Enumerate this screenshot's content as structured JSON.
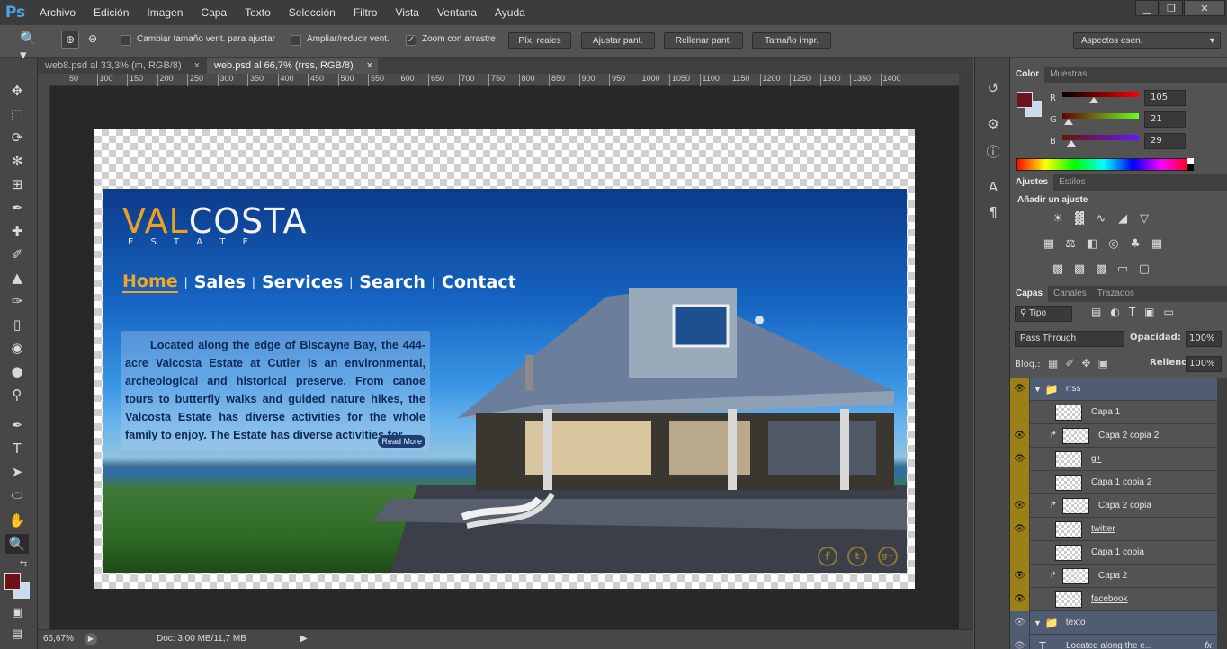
{
  "app": {
    "logo": "Ps"
  },
  "menu": [
    "Archivo",
    "Edición",
    "Imagen",
    "Capa",
    "Texto",
    "Selección",
    "Filtro",
    "Vista",
    "Ventana",
    "Ayuda"
  ],
  "window_controls": {
    "minimize": "▁",
    "restore": "❐",
    "close": "✕"
  },
  "options": {
    "resize_window_label": "Cambiar tamaño vent. para ajustar",
    "resize_window_checked": false,
    "zoom_all_label": "Ampliar/reducir vent.",
    "zoom_all_checked": false,
    "scrubby_zoom_label": "Zoom con arrastre",
    "scrubby_zoom_checked": true,
    "actual_pixels": "Píx. reales",
    "fit_screen": "Ajustar pant.",
    "fill_screen": "Rellenar pant.",
    "print_size": "Tamaño impr.",
    "workspace": "Aspectos esen."
  },
  "tabs": [
    {
      "label": "web8.psd al 33,3% (m, RGB/8)",
      "active": false
    },
    {
      "label": "web.psd al 66,7% (rrss, RGB/8)",
      "active": true
    }
  ],
  "ruler_ticks": [
    "50",
    "100",
    "150",
    "200",
    "250",
    "300",
    "350",
    "400",
    "450",
    "500",
    "550",
    "600",
    "650",
    "700",
    "750",
    "800",
    "850",
    "900",
    "950",
    "1000",
    "1050",
    "1100",
    "1150",
    "1200",
    "1250",
    "1300",
    "1350",
    "1400"
  ],
  "website": {
    "logo_val": "VAL",
    "logo_costa": "COSTA",
    "logo_estate": "E S T A T E",
    "nav": [
      "Home",
      "Sales",
      "Services",
      "Search",
      "Contact"
    ],
    "intro": "Located along the edge of Biscayne Bay, the 444-acre Valcosta Estate at Cutler is an environmental, archeological and historical preserve. From canoe tours to butterfly walks and guided nature hikes, the Valcosta Estate has diverse activities for the whole family to enjoy. The Estate has diverse activities for...",
    "read_more": "Read More",
    "social": [
      "f",
      "t",
      "g+"
    ]
  },
  "status": {
    "zoom": "66,67%",
    "doc": "Doc: 3,00 MB/11,7 MB"
  },
  "color_panel": {
    "tabs": [
      "Color",
      "Muestras"
    ],
    "r_label": "R",
    "r_value": "105",
    "g_label": "G",
    "g_value": "21",
    "b_label": "B",
    "b_value": "29",
    "foreground": "#69151d",
    "background": "#c8dcf0"
  },
  "adjust_panel": {
    "tabs": [
      "Ajustes",
      "Estilos"
    ],
    "title": "Añadir un ajuste"
  },
  "layers_panel": {
    "tabs": [
      "Capas",
      "Canales",
      "Trazados"
    ],
    "filter": "Tipo",
    "blend_mode": "Pass Through",
    "opacity_label": "Opacidad:",
    "opacity": "100%",
    "lock_label": "Bloq.:",
    "fill_label": "Relleno:",
    "fill": "100%",
    "layers": [
      {
        "name": "rrss",
        "type": "group",
        "visible": true
      },
      {
        "name": "Capa 1",
        "type": "layer",
        "visible": false,
        "clip": false
      },
      {
        "name": "Capa 2 copia 2",
        "type": "layer",
        "visible": true,
        "clip": true
      },
      {
        "name": "g+",
        "type": "layer",
        "visible": true,
        "clip": false,
        "underline": true
      },
      {
        "name": "Capa 1 copia 2",
        "type": "layer",
        "visible": false,
        "clip": false
      },
      {
        "name": "Capa 2 copia",
        "type": "layer",
        "visible": true,
        "clip": true
      },
      {
        "name": "twitter",
        "type": "layer",
        "visible": true,
        "clip": false,
        "underline": true
      },
      {
        "name": "Capa 1 copia",
        "type": "layer",
        "visible": false,
        "clip": false
      },
      {
        "name": "Capa 2",
        "type": "layer",
        "visible": true,
        "clip": true
      },
      {
        "name": "facebook",
        "type": "layer",
        "visible": true,
        "clip": false,
        "underline": true
      },
      {
        "name": "texto",
        "type": "group",
        "visible": true
      },
      {
        "name": "Located along the e...",
        "type": "text",
        "visible": true
      }
    ]
  }
}
